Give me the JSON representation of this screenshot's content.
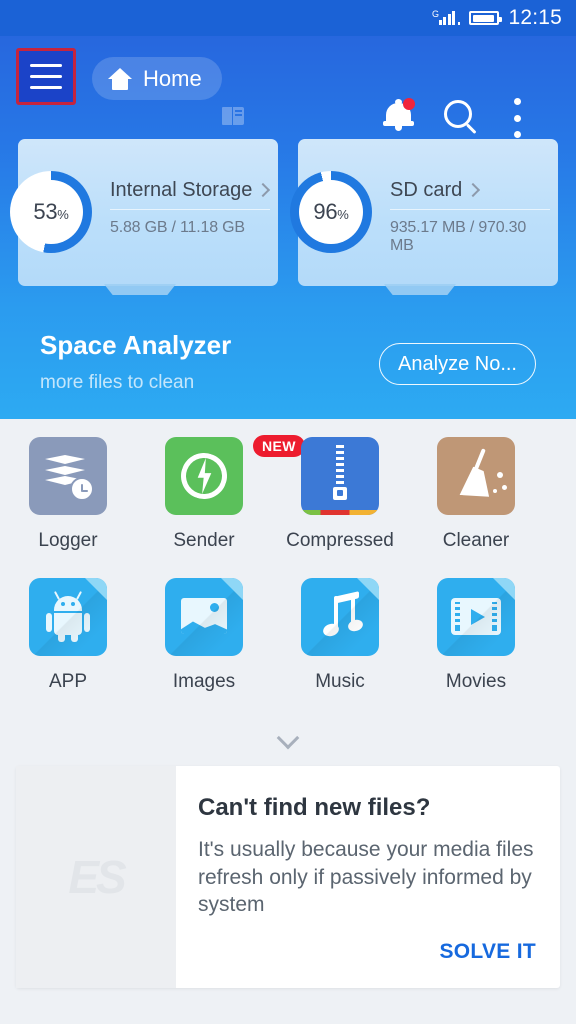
{
  "status_bar": {
    "network_type": "G",
    "signal_icon": "signal-bars-icon",
    "battery_icon": "battery-icon",
    "time": "12:15"
  },
  "action_bar": {
    "menu_icon": "hamburger-menu-icon",
    "home_label": "Home",
    "home_icon": "home-icon",
    "bookmark_icon": "bookmark-icon",
    "notification_icon": "bell-icon",
    "search_icon": "search-icon",
    "overflow_icon": "more-vertical-icon"
  },
  "storage_cards": [
    {
      "name": "Internal Storage",
      "percent": "53",
      "percent_value": 53,
      "percent_symbol": "%",
      "usage": "5.88 GB / 11.18 GB",
      "used": "5.88 GB",
      "total": "11.18 GB"
    },
    {
      "name": "SD card",
      "percent": "96",
      "percent_value": 96,
      "percent_symbol": "%",
      "usage": "935.17 MB / 970.30 MB",
      "used": "935.17 MB",
      "total": "970.30 MB"
    }
  ],
  "space_analyzer": {
    "title": "Space Analyzer",
    "subtitle": "more files to clean",
    "button_label": "Analyze No..."
  },
  "app_grid": {
    "rows": [
      [
        {
          "label": "Logger",
          "icon": "logger-icon",
          "badge": ""
        },
        {
          "label": "Sender",
          "icon": "sender-icon",
          "badge": "NEW"
        },
        {
          "label": "Compressed",
          "icon": "compressed-icon",
          "badge": ""
        },
        {
          "label": "Cleaner",
          "icon": "cleaner-icon",
          "badge": ""
        }
      ],
      [
        {
          "label": "APP",
          "icon": "android-app-icon",
          "badge": ""
        },
        {
          "label": "Images",
          "icon": "images-icon",
          "badge": ""
        },
        {
          "label": "Music",
          "icon": "music-icon",
          "badge": ""
        },
        {
          "label": "Movies",
          "icon": "movies-icon",
          "badge": ""
        }
      ]
    ],
    "expand_icon": "chevron-down-icon"
  },
  "tip_card": {
    "logo_text": "ES",
    "title": "Can't find new files?",
    "body": "It's usually because your media files refresh only if passively informed by system",
    "cta_label": "SOLVE IT"
  },
  "colors": {
    "header_top": "#2767DE",
    "header_bottom": "#2DAAF2",
    "status_bar": "#1B62D6",
    "accent_link": "#1669DE",
    "badge_red": "#ED1C2E",
    "highlight_border": "#C6243E",
    "page_bg": "#EEF1F5",
    "donut_track": "#FFFFFF",
    "donut_fill": "#2079E0"
  }
}
